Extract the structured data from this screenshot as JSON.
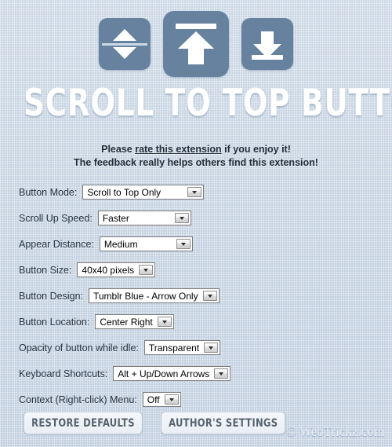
{
  "header": {
    "icons": [
      {
        "name": "scroll-both-icon",
        "label": "Scroll Up and Down"
      },
      {
        "name": "scroll-to-top-icon",
        "label": "Scroll to Top"
      },
      {
        "name": "scroll-to-bottom-icon",
        "label": "Scroll to Bottom"
      }
    ],
    "title": "SCROLL TO TOP BUTTON"
  },
  "subtitle": {
    "line1_before": "Please ",
    "line1_link": "rate this extension",
    "line1_after": " if you enjoy it!",
    "line2": "The feedback really helps others find this extension!"
  },
  "settings": [
    {
      "label": "Button Mode:",
      "value": "Scroll to Top Only",
      "size": "wide"
    },
    {
      "label": "Scroll Up Speed:",
      "value": "Faster",
      "size": "medium"
    },
    {
      "label": "Appear Distance:",
      "value": "Medium",
      "size": "medium"
    },
    {
      "label": "Button Size:",
      "value": "40x40 pixels",
      "size": "auto"
    },
    {
      "label": "Button Design:",
      "value": "Tumblr Blue - Arrow Only",
      "size": "auto"
    },
    {
      "label": "Button Location:",
      "value": "Center Right",
      "size": "auto"
    },
    {
      "label": "Opacity of button while idle:",
      "value": "Transparent",
      "size": "auto"
    },
    {
      "label": "Keyboard Shortcuts:",
      "value": "Alt + Up/Down Arrows",
      "size": "auto"
    },
    {
      "label": "Context (Right-click) Menu:",
      "value": "Off",
      "size": "auto"
    }
  ],
  "buttons": {
    "restore_defaults": "RESTORE DEFAULTS",
    "authors_settings": "AUTHOR'S SETTINGS"
  },
  "watermark": "© WebTrickz.com",
  "colors": {
    "background": "#ccd9e7",
    "tile": "#67829f",
    "title": "#ffffff",
    "text": "#223040"
  }
}
